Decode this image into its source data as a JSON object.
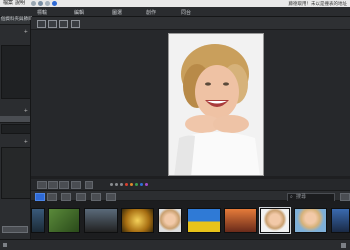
{
  "menubar": {
    "items": [
      "檔案",
      "說明"
    ],
    "sign_in": "藤德取用！未以是撞表的地址"
  },
  "tabs": [
    "標輸",
    "編輯",
    "圖選",
    "創作",
    "同台"
  ],
  "left_panel": {
    "header": "個資料夾與節目"
  },
  "filmstrip": {
    "search_placeholder": "搜尋"
  },
  "colors": {
    "accent_red": "#d9402f",
    "accent_blue": "#2e6fd8",
    "accent_purple": "#a44bc9",
    "accent_orange": "#e0892d",
    "accent_green": "#39a04f"
  }
}
